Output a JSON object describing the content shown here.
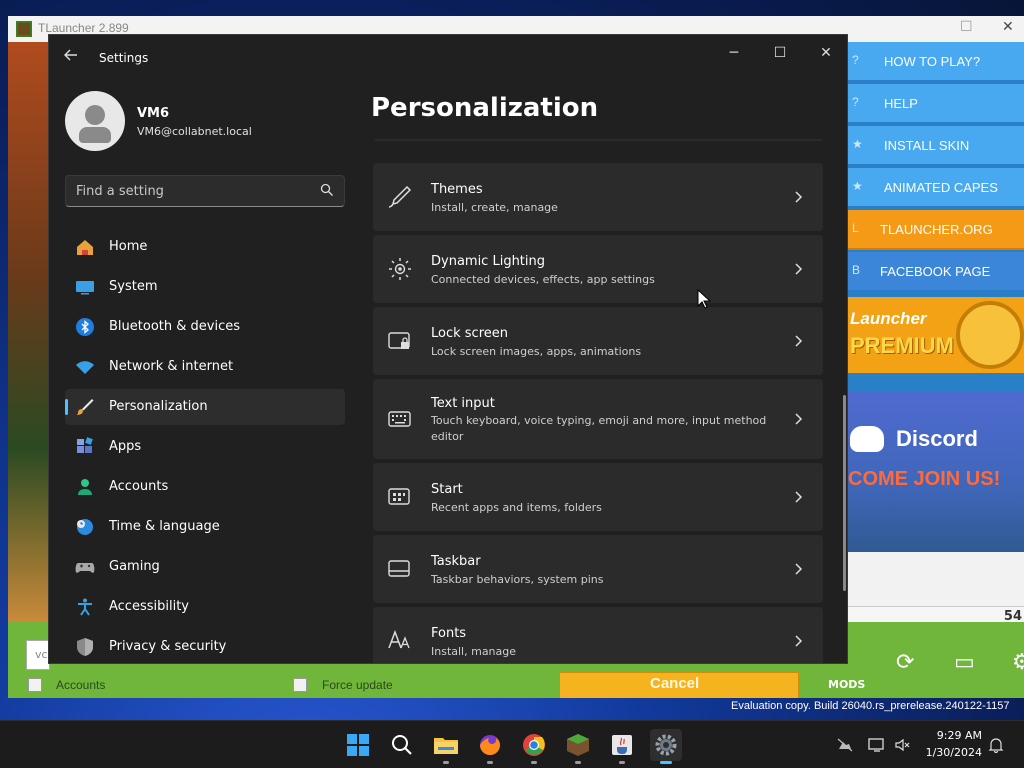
{
  "tlauncher": {
    "title": "TLauncher 2.899",
    "menu": [
      "HOW TO PLAY?",
      "HELP",
      "INSTALL SKIN",
      "ANIMATED CAPES",
      "TLAUNCHER.ORG",
      "FACEBOOK PAGE"
    ],
    "menu_icons": [
      "?",
      "?",
      "★",
      "★",
      "L",
      "B"
    ],
    "premium_line1": "Launcher",
    "premium_line2": "PREMIUM",
    "discord": "Discord",
    "discord_join": "COME JOIN US!",
    "counter": "54",
    "version_input": "vc",
    "accounts_label": "Accounts",
    "force_update_label": "Force update",
    "cancel_label": "Cancel",
    "mods_label": "MODS"
  },
  "settings": {
    "window_title": "Settings",
    "controls": {
      "minimize": "─",
      "maximize": "☐",
      "close": "✕"
    },
    "user": {
      "name": "VM6",
      "email": "VM6@collabnet.local"
    },
    "search": {
      "placeholder": "Find a setting"
    },
    "nav": [
      {
        "label": "Home",
        "icon": "home-icon"
      },
      {
        "label": "System",
        "icon": "system-icon"
      },
      {
        "label": "Bluetooth & devices",
        "icon": "bluetooth-icon"
      },
      {
        "label": "Network & internet",
        "icon": "wifi-icon"
      },
      {
        "label": "Personalization",
        "icon": "brush-icon",
        "active": true
      },
      {
        "label": "Apps",
        "icon": "apps-icon"
      },
      {
        "label": "Accounts",
        "icon": "account-icon"
      },
      {
        "label": "Time & language",
        "icon": "globe-clock-icon"
      },
      {
        "label": "Gaming",
        "icon": "gamepad-icon"
      },
      {
        "label": "Accessibility",
        "icon": "accessibility-icon"
      },
      {
        "label": "Privacy & security",
        "icon": "shield-icon"
      }
    ],
    "page_title": "Personalization",
    "cards": [
      {
        "title": "Themes",
        "subtitle": "Install, create, manage",
        "icon": "brush-pen-icon"
      },
      {
        "title": "Dynamic Lighting",
        "subtitle": "Connected devices, effects, app settings",
        "icon": "sun-lighting-icon"
      },
      {
        "title": "Lock screen",
        "subtitle": "Lock screen images, apps, animations",
        "icon": "lock-screen-icon"
      },
      {
        "title": "Text input",
        "subtitle": "Touch keyboard, voice typing, emoji and more, input method editor",
        "icon": "keyboard-icon"
      },
      {
        "title": "Start",
        "subtitle": "Recent apps and items, folders",
        "icon": "start-menu-icon"
      },
      {
        "title": "Taskbar",
        "subtitle": "Taskbar behaviors, system pins",
        "icon": "taskbar-icon"
      },
      {
        "title": "Fonts",
        "subtitle": "Install, manage",
        "icon": "fonts-icon"
      }
    ]
  },
  "watermark": "Evaluation copy. Build 26040.rs_prerelease.240122-1157",
  "taskbar": {
    "apps": [
      "start-icon",
      "search-icon",
      "file-explorer-icon",
      "firefox-icon",
      "chrome-icon",
      "minecraft-icon",
      "java-icon",
      "settings-icon"
    ],
    "time": "9:29 AM",
    "date": "1/30/2024"
  },
  "colors": {
    "accent": "#4cc2ff",
    "window_bg": "#202020",
    "card_bg": "#2b2b2b"
  }
}
